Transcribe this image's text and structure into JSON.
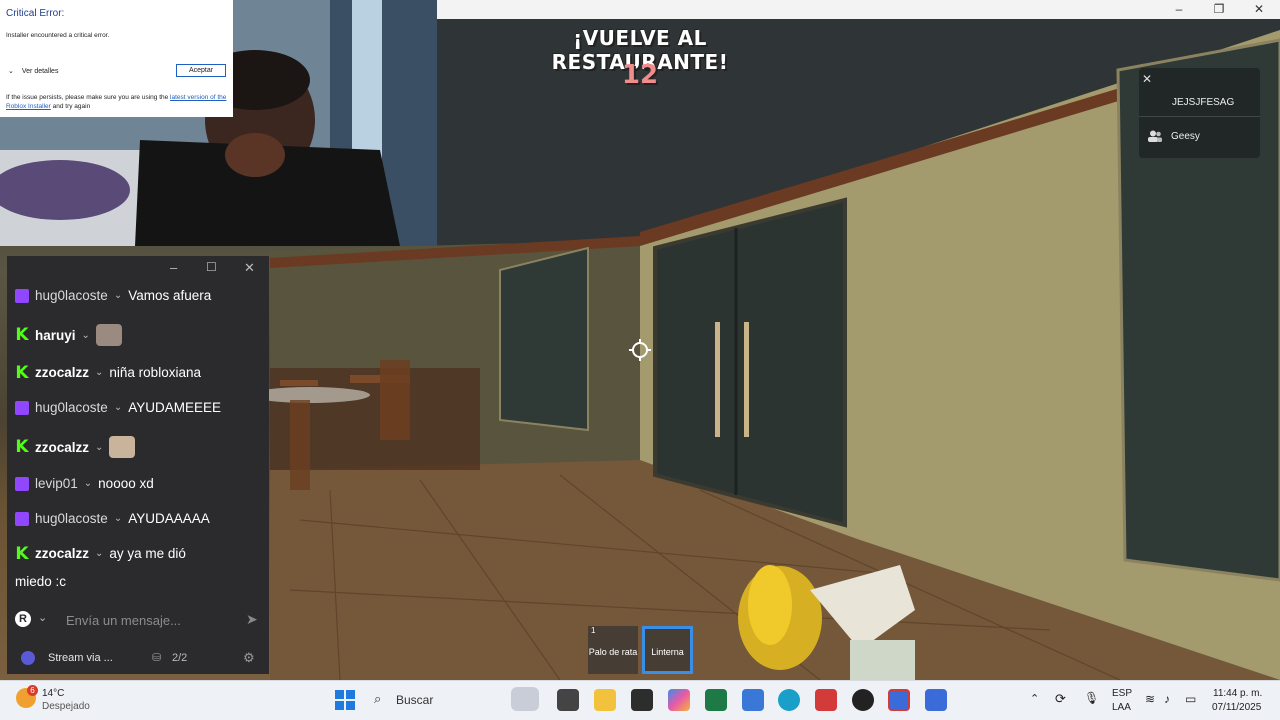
{
  "game": {
    "title": "¡VUELVE AL RESTAURANTE!",
    "counter": "12",
    "players_panel": {
      "label": "JEJSJFESAG",
      "player": "Geesy"
    },
    "hotbar": [
      {
        "num": "1",
        "name": "Palo de rata",
        "active": false
      },
      {
        "num": "",
        "name": "Linterna",
        "active": true
      }
    ]
  },
  "error_dialog": {
    "title": "Critical Error:",
    "message": "Installer encountered a critical error.",
    "details_label": "Ver detalles",
    "accept_label": "Aceptar",
    "footer_prefix": "If the issue persists, please make sure you are using the",
    "footer_link": "latest version of the Roblox Installer",
    "footer_suffix": "and try again"
  },
  "chat": {
    "messages": [
      {
        "platform": "twitch",
        "user": "hug0lacoste",
        "text": "Vamos afuera"
      },
      {
        "platform": "kick",
        "user": "haruyi",
        "text": ""
      },
      {
        "platform": "kick",
        "user": "zzocalzz",
        "text": "niña robloxiana"
      },
      {
        "platform": "twitch",
        "user": "hug0lacoste",
        "text": "AYUDAMEEEE"
      },
      {
        "platform": "kick",
        "user": "zzocalzz",
        "text": ""
      },
      {
        "platform": "twitch",
        "user": "levip01",
        "text": "noooo xd"
      },
      {
        "platform": "twitch",
        "user": "hug0lacoste",
        "text": "AYUDAAAAA"
      },
      {
        "platform": "kick",
        "user": "zzocalzz",
        "text": "ay ya me dió"
      }
    ],
    "continuation": "miedo :c",
    "input_placeholder": "Envía un mensaje...",
    "stream_label": "Stream via ...",
    "viewers": "2/2"
  },
  "taskbar": {
    "weather_temp": "14°C",
    "weather_desc": "Despejado",
    "weather_badge": "6",
    "search_label": "Buscar",
    "lang_top": "ESP",
    "lang_bottom": "LAA",
    "time": "11:44 p. m.",
    "date": "07/11/2025",
    "icons": [
      "start-icon",
      "search-icon",
      "file-explorer-icon",
      "notion-icon",
      "copilot-icon",
      "excel-icon",
      "todo-icon",
      "edge-icon",
      "roblox-studio-icon",
      "obs-icon",
      "roblox-icon",
      "roblox-player-icon"
    ]
  },
  "colors": {
    "twitch": "#9146ff",
    "kick": "#53fc18",
    "accent": "#3b8ee6",
    "counter": "#ef8d8d"
  }
}
